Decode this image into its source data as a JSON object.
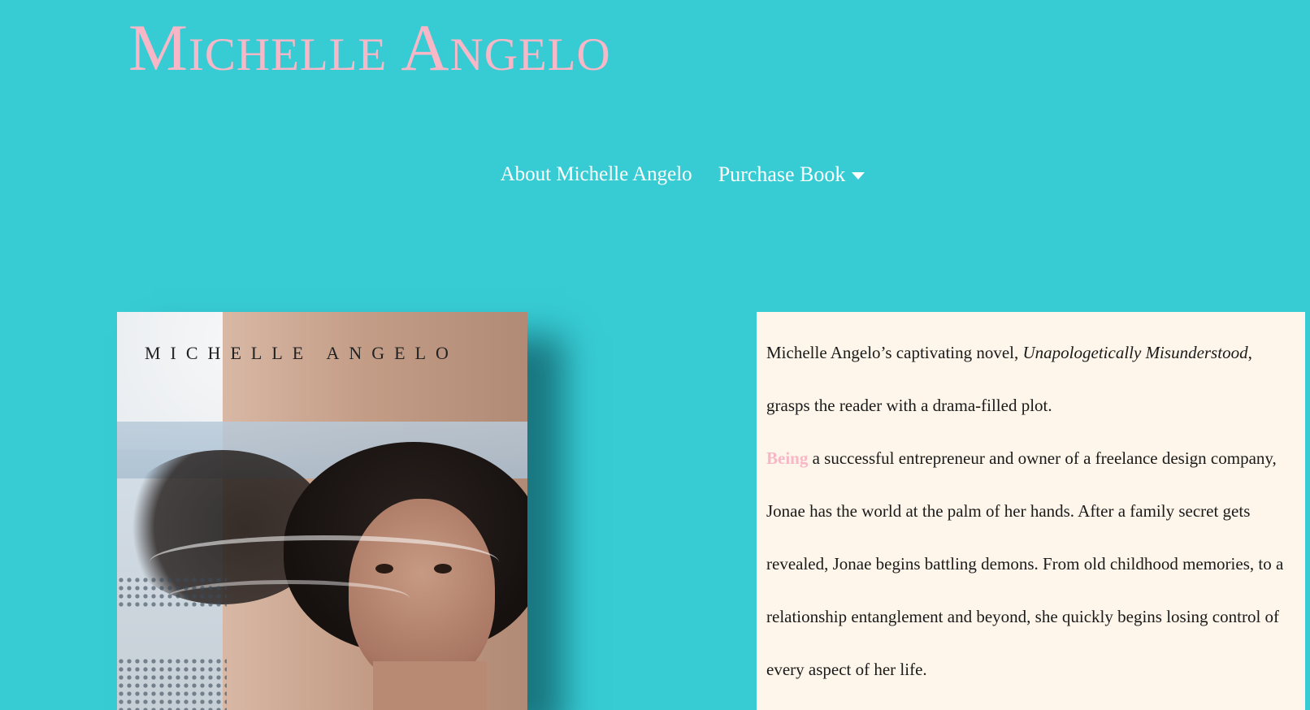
{
  "header": {
    "site_title": "Michelle Angelo"
  },
  "nav": {
    "items": [
      {
        "label": "About Michelle Angelo"
      },
      {
        "label": "Purchase Book"
      }
    ]
  },
  "book_cover": {
    "author_text": "MICHELLE ANGELO"
  },
  "description": {
    "p1_before": "Michelle Angelo’s captivating novel, ",
    "p1_title": "Unapologetically Misunderstood",
    "p1_after": ", grasps the reader with a drama-filled plot.",
    "p2_highlight": "Being",
    "p2_rest": " a successful entrepreneur and owner of a freelance design company, Jonae has the world at the palm of her hands. After a family secret gets revealed, Jonae begins battling demons. From old childhood memories, to a relationship entanglement and beyond, she quickly begins losing control of every aspect of her life."
  },
  "colors": {
    "background": "#37ccd4",
    "accent_pink": "#f7b7c6",
    "content_bg": "#fef6ea"
  }
}
